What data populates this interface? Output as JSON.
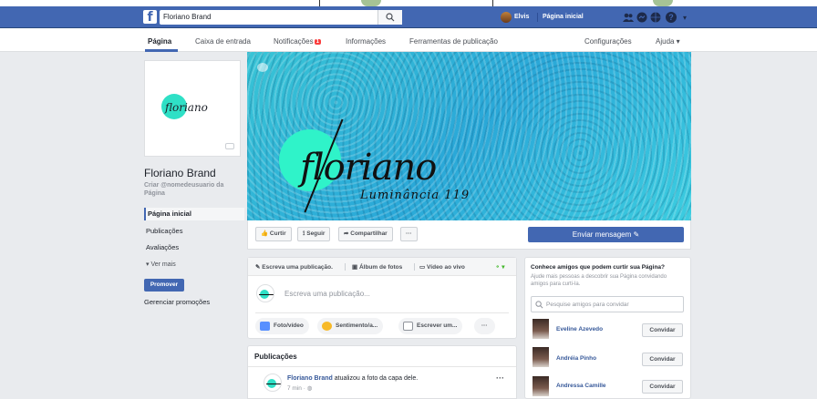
{
  "topbar": {
    "search_value": "Floriano Brand",
    "user_name": "Elvis",
    "home_link": "Página inicial",
    "fb_letter": "f"
  },
  "page_tabs": [
    "Página",
    "Caixa de entrada",
    "Notificações",
    "Informações",
    "Ferramentas de publicação",
    "Configurações",
    "Ajuda ▾"
  ],
  "notification_count": "1",
  "left": {
    "page_name": "Floriano Brand",
    "username_hint": "Criar @nomedeusuario da Página",
    "profile_logo_text": "floriano",
    "nav": [
      "Página inicial",
      "Publicações",
      "Avaliações"
    ],
    "see_more": "Ver mais",
    "promote_label": "Promover",
    "manage_promotions": "Gerenciar promoções"
  },
  "cover": {
    "logo_text": "floriano",
    "subtitle": "Luminância 119"
  },
  "actions": {
    "like": "Curtir",
    "follow": "Seguir",
    "share": "Compartilhar",
    "more": "···",
    "send_message": "Enviar mensagem"
  },
  "composer": {
    "tabs": [
      "Escreva uma publicação.",
      "Álbum de fotos",
      "Vídeo ao vivo"
    ],
    "placeholder": "Escreva uma publicação...",
    "buttons": [
      "Foto/vídeo",
      "Sentimento/a...",
      "Escrever um...",
      "···"
    ]
  },
  "publications": {
    "title": "Publicações",
    "post_author": "Floriano Brand",
    "post_action": "atualizou a foto da capa dele.",
    "post_time": "7 min",
    "post_more": "···"
  },
  "friends": {
    "title": "Conhece amigos que podem curtir sua Página?",
    "description": "Ajude mais pessoas a descobrir sua Página convidando amigos para curti-la.",
    "search_placeholder": "Pesquise amigos para convidar",
    "invite_label": "Convidar",
    "list": [
      {
        "name": "Eveline Azevedo"
      },
      {
        "name": "Andréia Pinho"
      },
      {
        "name": "Andressa Camille"
      }
    ]
  },
  "colors": {
    "brand_blue": "#4267b2",
    "cover_teal": "#2fe0c6",
    "notification_red": "#fa3e3e"
  }
}
